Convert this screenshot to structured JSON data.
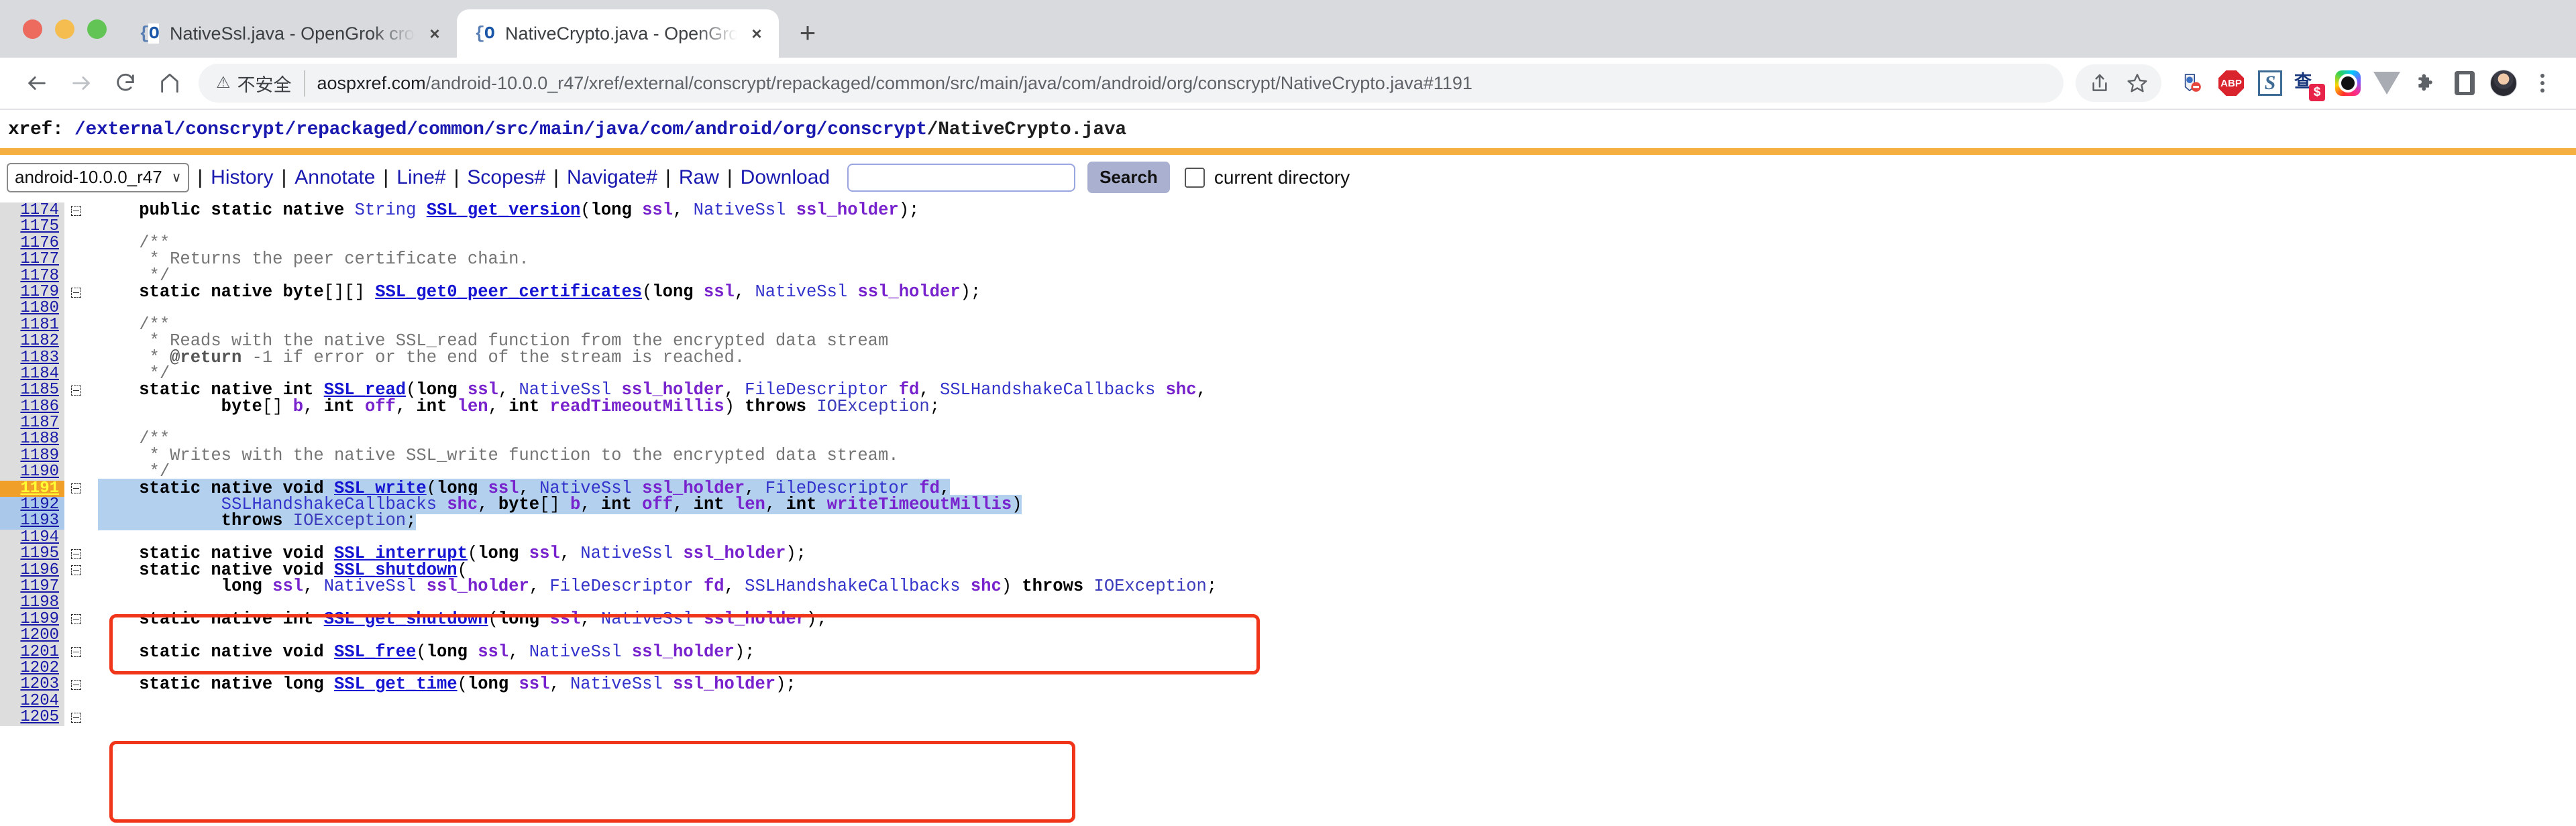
{
  "browser": {
    "tabs": [
      {
        "title": "NativeSsl.java - OpenGrok cros",
        "favicon": "opengrok-brace-icon",
        "active": false
      },
      {
        "title": "NativeCrypto.java - OpenGrok c",
        "favicon": "opengrok-brace-icon",
        "active": true
      }
    ],
    "new_tab_label": "+",
    "close_label": "×",
    "security": {
      "icon": "warning-triangle-icon",
      "text": "不安全"
    },
    "url_host": "aospxref.com",
    "url_path": "/android-10.0.0_r47/xref/external/conscrypt/repackaged/common/src/main/java/com/android/org/conscrypt/NativeCrypto.java#1191",
    "toolbar_icons": [
      "share-icon",
      "bookmark-star-icon",
      "adblock-extension-icon",
      "abp-extension-icon",
      "sdict-extension-icon",
      "honey-extension-icon",
      "colorpick-extension-icon",
      "vue-devtools-extension-icon",
      "extensions-puzzle-icon",
      "side-panel-icon",
      "profile-avatar-icon",
      "chrome-menu-icon"
    ],
    "abp_label": "ABP",
    "sdict_label": "S",
    "honey_badge": "$"
  },
  "opengrok": {
    "xref_label": "xref: ",
    "path_segments": [
      "/external",
      "/conscrypt",
      "/repackaged",
      "/common",
      "/src",
      "/main",
      "/java",
      "/com",
      "/android",
      "/org",
      "/conscrypt"
    ],
    "path_file": "/NativeCrypto.java",
    "project": "android-10.0.0_r47",
    "chevron": "∨",
    "nav_links": [
      "History",
      "Annotate",
      "Line#",
      "Scopes#",
      "Navigate#",
      "Raw",
      "Download"
    ],
    "separator": "|",
    "search_value": "",
    "search_placeholder": "",
    "search_button": "Search",
    "current_directory_label": "current directory"
  },
  "code": {
    "lines": [
      {
        "n": "1174",
        "fold": true,
        "tokens": [
          {
            "t": "    ",
            "c": "pl"
          },
          {
            "t": "public static native ",
            "c": "k"
          },
          {
            "t": "String",
            "c": "ty"
          },
          {
            "t": " ",
            "c": "pl"
          },
          {
            "t": "SSL_get_version",
            "c": "fn"
          },
          {
            "t": "(",
            "c": "pl"
          },
          {
            "t": "long",
            "c": "k"
          },
          {
            "t": " ",
            "c": "pl"
          },
          {
            "t": "ssl",
            "c": "var"
          },
          {
            "t": ", ",
            "c": "pl"
          },
          {
            "t": "NativeSsl",
            "c": "ty"
          },
          {
            "t": " ",
            "c": "pl"
          },
          {
            "t": "ssl_holder",
            "c": "var"
          },
          {
            "t": ");",
            "c": "pl"
          }
        ]
      },
      {
        "n": "1175",
        "fold": false,
        "tokens": []
      },
      {
        "n": "1176",
        "fold": false,
        "tokens": [
          {
            "t": "    /**",
            "c": "cm"
          }
        ]
      },
      {
        "n": "1177",
        "fold": false,
        "tokens": [
          {
            "t": "     * Returns the peer certificate chain.",
            "c": "cm"
          }
        ]
      },
      {
        "n": "1178",
        "fold": false,
        "tokens": [
          {
            "t": "     */",
            "c": "cm"
          }
        ]
      },
      {
        "n": "1179",
        "fold": true,
        "tokens": [
          {
            "t": "    ",
            "c": "pl"
          },
          {
            "t": "static native byte",
            "c": "k"
          },
          {
            "t": "[][] ",
            "c": "pl"
          },
          {
            "t": "SSL_get0_peer_certificates",
            "c": "fn"
          },
          {
            "t": "(",
            "c": "pl"
          },
          {
            "t": "long",
            "c": "k"
          },
          {
            "t": " ",
            "c": "pl"
          },
          {
            "t": "ssl",
            "c": "var"
          },
          {
            "t": ", ",
            "c": "pl"
          },
          {
            "t": "NativeSsl",
            "c": "ty"
          },
          {
            "t": " ",
            "c": "pl"
          },
          {
            "t": "ssl_holder",
            "c": "var"
          },
          {
            "t": ");",
            "c": "pl"
          }
        ]
      },
      {
        "n": "1180",
        "fold": false,
        "tokens": []
      },
      {
        "n": "1181",
        "fold": false,
        "tokens": [
          {
            "t": "    /**",
            "c": "cm"
          }
        ]
      },
      {
        "n": "1182",
        "fold": false,
        "tokens": [
          {
            "t": "     * Reads with the native SSL_read function from the encrypted data stream",
            "c": "cm"
          }
        ]
      },
      {
        "n": "1183",
        "fold": false,
        "tokens": [
          {
            "t": "     * ",
            "c": "cm"
          },
          {
            "t": "@return",
            "c": "cmb"
          },
          {
            "t": " -1 if error or the end of the stream is reached.",
            "c": "cm"
          }
        ]
      },
      {
        "n": "1184",
        "fold": false,
        "tokens": [
          {
            "t": "     */",
            "c": "cm"
          }
        ]
      },
      {
        "n": "1185",
        "fold": true,
        "tokens": [
          {
            "t": "    ",
            "c": "pl"
          },
          {
            "t": "static native int",
            "c": "k"
          },
          {
            "t": " ",
            "c": "pl"
          },
          {
            "t": "SSL_read",
            "c": "fn"
          },
          {
            "t": "(",
            "c": "pl"
          },
          {
            "t": "long",
            "c": "k"
          },
          {
            "t": " ",
            "c": "pl"
          },
          {
            "t": "ssl",
            "c": "var"
          },
          {
            "t": ", ",
            "c": "pl"
          },
          {
            "t": "NativeSsl",
            "c": "ty"
          },
          {
            "t": " ",
            "c": "pl"
          },
          {
            "t": "ssl_holder",
            "c": "var"
          },
          {
            "t": ", ",
            "c": "pl"
          },
          {
            "t": "FileDescriptor",
            "c": "ty"
          },
          {
            "t": " ",
            "c": "pl"
          },
          {
            "t": "fd",
            "c": "var"
          },
          {
            "t": ", ",
            "c": "pl"
          },
          {
            "t": "SSLHandshakeCallbacks",
            "c": "ty"
          },
          {
            "t": " ",
            "c": "pl"
          },
          {
            "t": "shc",
            "c": "var"
          },
          {
            "t": ",",
            "c": "pl"
          }
        ]
      },
      {
        "n": "1186",
        "fold": false,
        "tokens": [
          {
            "t": "            ",
            "c": "pl"
          },
          {
            "t": "byte",
            "c": "k"
          },
          {
            "t": "[] ",
            "c": "pl"
          },
          {
            "t": "b",
            "c": "var"
          },
          {
            "t": ", ",
            "c": "pl"
          },
          {
            "t": "int",
            "c": "k"
          },
          {
            "t": " ",
            "c": "pl"
          },
          {
            "t": "off",
            "c": "var"
          },
          {
            "t": ", ",
            "c": "pl"
          },
          {
            "t": "int",
            "c": "k"
          },
          {
            "t": " ",
            "c": "pl"
          },
          {
            "t": "len",
            "c": "var"
          },
          {
            "t": ", ",
            "c": "pl"
          },
          {
            "t": "int",
            "c": "k"
          },
          {
            "t": " ",
            "c": "pl"
          },
          {
            "t": "readTimeoutMillis",
            "c": "var"
          },
          {
            "t": ") ",
            "c": "pl"
          },
          {
            "t": "throws",
            "c": "k"
          },
          {
            "t": " ",
            "c": "pl"
          },
          {
            "t": "IOException",
            "c": "ex"
          },
          {
            "t": ";",
            "c": "pl"
          }
        ]
      },
      {
        "n": "1187",
        "fold": false,
        "tokens": []
      },
      {
        "n": "1188",
        "fold": false,
        "tokens": [
          {
            "t": "    /**",
            "c": "cm"
          }
        ]
      },
      {
        "n": "1189",
        "fold": false,
        "tokens": [
          {
            "t": "     * Writes with the native SSL_write function to the encrypted data stream.",
            "c": "cm"
          }
        ]
      },
      {
        "n": "1190",
        "fold": false,
        "tokens": [
          {
            "t": "     */",
            "c": "cm"
          }
        ]
      },
      {
        "n": "1191",
        "fold": true,
        "state": "highlight",
        "tokens": [
          {
            "t": "    ",
            "c": "pl"
          },
          {
            "t": "static native void",
            "c": "k"
          },
          {
            "t": " ",
            "c": "pl"
          },
          {
            "t": "SSL_write",
            "c": "fn"
          },
          {
            "t": "(",
            "c": "pl"
          },
          {
            "t": "long",
            "c": "k"
          },
          {
            "t": " ",
            "c": "pl"
          },
          {
            "t": "ssl",
            "c": "var"
          },
          {
            "t": ", ",
            "c": "pl"
          },
          {
            "t": "NativeSsl",
            "c": "ty"
          },
          {
            "t": " ",
            "c": "pl"
          },
          {
            "t": "ssl_holder",
            "c": "var"
          },
          {
            "t": ", ",
            "c": "pl"
          },
          {
            "t": "FileDescriptor",
            "c": "ty"
          },
          {
            "t": " ",
            "c": "pl"
          },
          {
            "t": "fd",
            "c": "var"
          },
          {
            "t": ",",
            "c": "pl"
          }
        ]
      },
      {
        "n": "1192",
        "fold": false,
        "state": "selected",
        "tokens": [
          {
            "t": "            ",
            "c": "pl"
          },
          {
            "t": "SSLHandshakeCallbacks",
            "c": "ty"
          },
          {
            "t": " ",
            "c": "pl"
          },
          {
            "t": "shc",
            "c": "var"
          },
          {
            "t": ", ",
            "c": "pl"
          },
          {
            "t": "byte",
            "c": "k"
          },
          {
            "t": "[] ",
            "c": "pl"
          },
          {
            "t": "b",
            "c": "var"
          },
          {
            "t": ", ",
            "c": "pl"
          },
          {
            "t": "int",
            "c": "k"
          },
          {
            "t": " ",
            "c": "pl"
          },
          {
            "t": "off",
            "c": "var"
          },
          {
            "t": ", ",
            "c": "pl"
          },
          {
            "t": "int",
            "c": "k"
          },
          {
            "t": " ",
            "c": "pl"
          },
          {
            "t": "len",
            "c": "var"
          },
          {
            "t": ", ",
            "c": "pl"
          },
          {
            "t": "int",
            "c": "k"
          },
          {
            "t": " ",
            "c": "pl"
          },
          {
            "t": "writeTimeoutMillis",
            "c": "var"
          },
          {
            "t": ")",
            "c": "pl"
          }
        ]
      },
      {
        "n": "1193",
        "fold": false,
        "state": "selected",
        "tokens": [
          {
            "t": "            ",
            "c": "pl"
          },
          {
            "t": "throws",
            "c": "k"
          },
          {
            "t": " ",
            "c": "pl"
          },
          {
            "t": "IOException",
            "c": "ex"
          },
          {
            "t": ";",
            "c": "pl"
          }
        ]
      },
      {
        "n": "1194",
        "fold": false,
        "tokens": []
      },
      {
        "n": "1195",
        "fold": true,
        "tokens": [
          {
            "t": "    ",
            "c": "pl"
          },
          {
            "t": "static native void",
            "c": "k"
          },
          {
            "t": " ",
            "c": "pl"
          },
          {
            "t": "SSL_interrupt",
            "c": "fn"
          },
          {
            "t": "(",
            "c": "pl"
          },
          {
            "t": "long",
            "c": "k"
          },
          {
            "t": " ",
            "c": "pl"
          },
          {
            "t": "ssl",
            "c": "var"
          },
          {
            "t": ", ",
            "c": "pl"
          },
          {
            "t": "NativeSsl",
            "c": "ty"
          },
          {
            "t": " ",
            "c": "pl"
          },
          {
            "t": "ssl_holder",
            "c": "var"
          },
          {
            "t": ");",
            "c": "pl"
          }
        ]
      },
      {
        "n": "1196",
        "fold": true,
        "tokens": [
          {
            "t": "    ",
            "c": "pl"
          },
          {
            "t": "static native void",
            "c": "k"
          },
          {
            "t": " ",
            "c": "pl"
          },
          {
            "t": "SSL_shutdown",
            "c": "fn"
          },
          {
            "t": "(",
            "c": "pl"
          }
        ]
      },
      {
        "n": "1197",
        "fold": false,
        "tokens": [
          {
            "t": "            ",
            "c": "pl"
          },
          {
            "t": "long",
            "c": "k"
          },
          {
            "t": " ",
            "c": "pl"
          },
          {
            "t": "ssl",
            "c": "var"
          },
          {
            "t": ", ",
            "c": "pl"
          },
          {
            "t": "NativeSsl",
            "c": "ty"
          },
          {
            "t": " ",
            "c": "pl"
          },
          {
            "t": "ssl_holder",
            "c": "var"
          },
          {
            "t": ", ",
            "c": "pl"
          },
          {
            "t": "FileDescriptor",
            "c": "ty"
          },
          {
            "t": " ",
            "c": "pl"
          },
          {
            "t": "fd",
            "c": "var"
          },
          {
            "t": ", ",
            "c": "pl"
          },
          {
            "t": "SSLHandshakeCallbacks",
            "c": "ty"
          },
          {
            "t": " ",
            "c": "pl"
          },
          {
            "t": "shc",
            "c": "var"
          },
          {
            "t": ") ",
            "c": "pl"
          },
          {
            "t": "throws",
            "c": "k"
          },
          {
            "t": " ",
            "c": "pl"
          },
          {
            "t": "IOException",
            "c": "ex"
          },
          {
            "t": ";",
            "c": "pl"
          }
        ]
      },
      {
        "n": "1198",
        "fold": false,
        "tokens": []
      },
      {
        "n": "1199",
        "fold": true,
        "tokens": [
          {
            "t": "    ",
            "c": "pl"
          },
          {
            "t": "static native int",
            "c": "k"
          },
          {
            "t": " ",
            "c": "pl"
          },
          {
            "t": "SSL_get_shutdown",
            "c": "fn"
          },
          {
            "t": "(",
            "c": "pl"
          },
          {
            "t": "long",
            "c": "k"
          },
          {
            "t": " ",
            "c": "pl"
          },
          {
            "t": "ssl",
            "c": "var"
          },
          {
            "t": ", ",
            "c": "pl"
          },
          {
            "t": "NativeSsl",
            "c": "ty"
          },
          {
            "t": " ",
            "c": "pl"
          },
          {
            "t": "ssl_holder",
            "c": "var"
          },
          {
            "t": ");",
            "c": "pl"
          }
        ]
      },
      {
        "n": "1200",
        "fold": false,
        "tokens": []
      },
      {
        "n": "1201",
        "fold": true,
        "tokens": [
          {
            "t": "    ",
            "c": "pl"
          },
          {
            "t": "static native void",
            "c": "k"
          },
          {
            "t": " ",
            "c": "pl"
          },
          {
            "t": "SSL_free",
            "c": "fn"
          },
          {
            "t": "(",
            "c": "pl"
          },
          {
            "t": "long",
            "c": "k"
          },
          {
            "t": " ",
            "c": "pl"
          },
          {
            "t": "ssl",
            "c": "var"
          },
          {
            "t": ", ",
            "c": "pl"
          },
          {
            "t": "NativeSsl",
            "c": "ty"
          },
          {
            "t": " ",
            "c": "pl"
          },
          {
            "t": "ssl_holder",
            "c": "var"
          },
          {
            "t": ");",
            "c": "pl"
          }
        ]
      },
      {
        "n": "1202",
        "fold": false,
        "tokens": []
      },
      {
        "n": "1203",
        "fold": true,
        "tokens": [
          {
            "t": "    ",
            "c": "pl"
          },
          {
            "t": "static native long",
            "c": "k"
          },
          {
            "t": " ",
            "c": "pl"
          },
          {
            "t": "SSL_get_time",
            "c": "fn"
          },
          {
            "t": "(",
            "c": "pl"
          },
          {
            "t": "long",
            "c": "k"
          },
          {
            "t": " ",
            "c": "pl"
          },
          {
            "t": "ssl",
            "c": "var"
          },
          {
            "t": ", ",
            "c": "pl"
          },
          {
            "t": "NativeSsl",
            "c": "ty"
          },
          {
            "t": " ",
            "c": "pl"
          },
          {
            "t": "ssl_holder",
            "c": "var"
          },
          {
            "t": ");",
            "c": "pl"
          }
        ]
      },
      {
        "n": "1204",
        "fold": false,
        "tokens": []
      },
      {
        "n": "1205",
        "fold": true,
        "tokens": []
      }
    ]
  },
  "annotations": {
    "boxes": [
      {
        "name": "ssl-read-highlight-box",
        "color": "#f0351b"
      },
      {
        "name": "ssl-write-highlight-box",
        "color": "#f0351b"
      }
    ]
  }
}
